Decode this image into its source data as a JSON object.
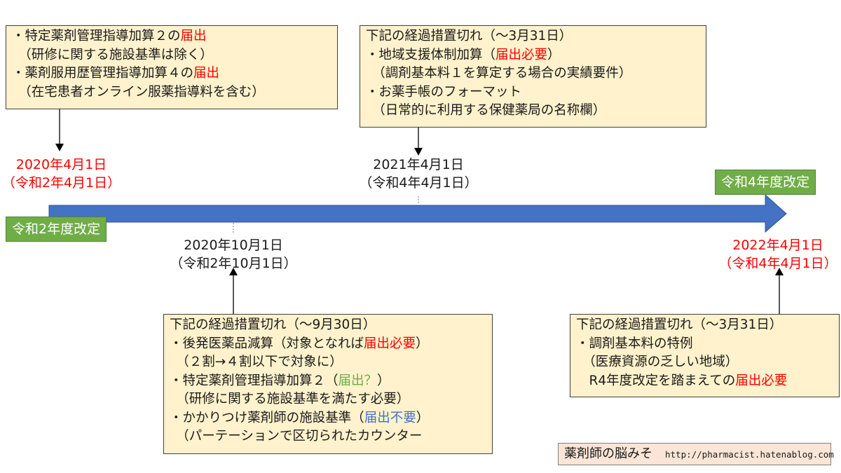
{
  "colors": {
    "arrow": "#4472c4",
    "note_bg": "#fff2cc",
    "tag_bg": "#70ad47",
    "highlight_red": "#ff0000",
    "highlight_green": "#70ad47",
    "highlight_blue": "#4472c4",
    "credit_bg": "#fbe5d6"
  },
  "tags": {
    "start": "令和2年度改定",
    "end": "令和4年度改定"
  },
  "dates": {
    "d1": {
      "line1": "2020年4月1日",
      "line2": "（令和2年4月1日）"
    },
    "d2": {
      "line1": "2020年10月1日",
      "line2": "（令和2年10月1日）"
    },
    "d3": {
      "line1": "2021年4月1日",
      "line2": "（令和4年4月1日）"
    },
    "d4": {
      "line1": "2022年4月1日",
      "line2": "（令和4年4月1日）"
    }
  },
  "notes": {
    "n1": {
      "l1a": "・特定薬剤管理指導加算２の",
      "l1b": "届出",
      "l2": "　（研修に関する施設基準は除く）",
      "l3a": "・薬剤服用歴管理指導加算４の",
      "l3b": "届出",
      "l4": "　（在宅患者オンライン服薬指導料を含む）"
    },
    "n2": {
      "l1": "下記の経過措置切れ（～3月31日）",
      "l2a": "・地域支援体制加算（",
      "l2b": "届出必要",
      "l2c": "）",
      "l3": "　（調剤基本料１を算定する場合の実績要件）",
      "l4": "・お薬手帳のフォーマット",
      "l5": "　（日常的に利用する保健薬局の名称欄）"
    },
    "n3": {
      "l1": "下記の経過措置切れ（～9月30日）",
      "l2a": "・後発医薬品減算（対象となれば",
      "l2b": "届出必要",
      "l2c": "）",
      "l3": "　（２割→４割以下で対象に）",
      "l4a": "・特定薬剤管理指導加算２（",
      "l4b": "届出？",
      "l4c": "）",
      "l5": "　（研修に関する施設基準を満たす必要）",
      "l6a": "・かかりつけ薬剤師の施設基準（",
      "l6b": "届出不要",
      "l6c": "）",
      "l7": "　（パーテーションで区切られたカウンター"
    },
    "n4": {
      "l1": "下記の経過措置切れ（～3月31日）",
      "l2": "・調剤基本料の特例",
      "l3": "　（医療資源の乏しい地域）",
      "l4a": "　R4年度改定を踏まえての",
      "l4b": "届出必要"
    }
  },
  "credit": {
    "name": "薬剤師の脳みそ",
    "url": "http://pharmacist.hatenablog.com"
  }
}
